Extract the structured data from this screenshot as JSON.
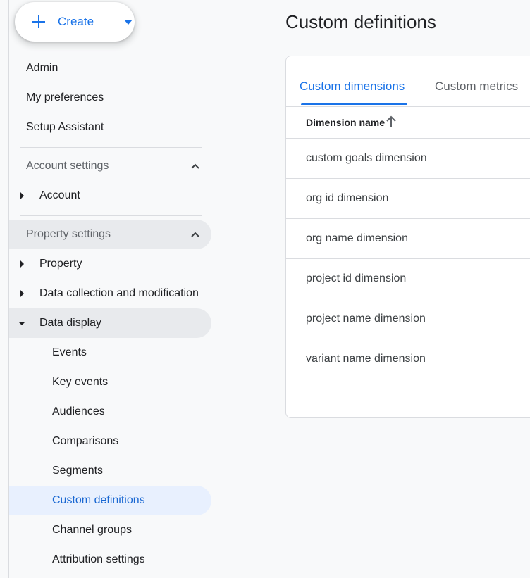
{
  "create_button": {
    "label": "Create"
  },
  "sidebar": {
    "top_items": [
      {
        "label": "Admin"
      },
      {
        "label": "My preferences"
      },
      {
        "label": "Setup Assistant"
      }
    ],
    "account_settings": {
      "header": "Account settings",
      "items": [
        {
          "label": "Account"
        }
      ]
    },
    "property_settings": {
      "header": "Property settings",
      "items": [
        {
          "label": "Property"
        },
        {
          "label": "Data collection and modification"
        },
        {
          "label": "Data display"
        }
      ],
      "data_display_children": [
        {
          "label": "Events"
        },
        {
          "label": "Key events"
        },
        {
          "label": "Audiences"
        },
        {
          "label": "Comparisons"
        },
        {
          "label": "Segments"
        },
        {
          "label": "Custom definitions",
          "selected": true
        },
        {
          "label": "Channel groups"
        },
        {
          "label": "Attribution settings"
        }
      ]
    }
  },
  "main": {
    "title": "Custom definitions",
    "tabs": [
      {
        "label": "Custom dimensions",
        "active": true
      },
      {
        "label": "Custom metrics",
        "active": false
      }
    ],
    "table": {
      "column_header": "Dimension name",
      "sort": "ascending",
      "rows": [
        "custom goals dimension",
        "org id dimension",
        "org name dimension",
        "project id dimension",
        "project name dimension",
        "variant name dimension"
      ]
    }
  },
  "colors": {
    "accent": "#1a73e8",
    "selected_bg": "#e8f0fe",
    "expanded_bg": "#e8eaed",
    "page_bg": "#f8f9fa"
  },
  "icons": [
    "plus-icon",
    "dropdown-caret-icon",
    "chevron-up-icon",
    "expand-triangle-icon",
    "collapse-triangle-icon",
    "sort-arrow-up-icon"
  ]
}
